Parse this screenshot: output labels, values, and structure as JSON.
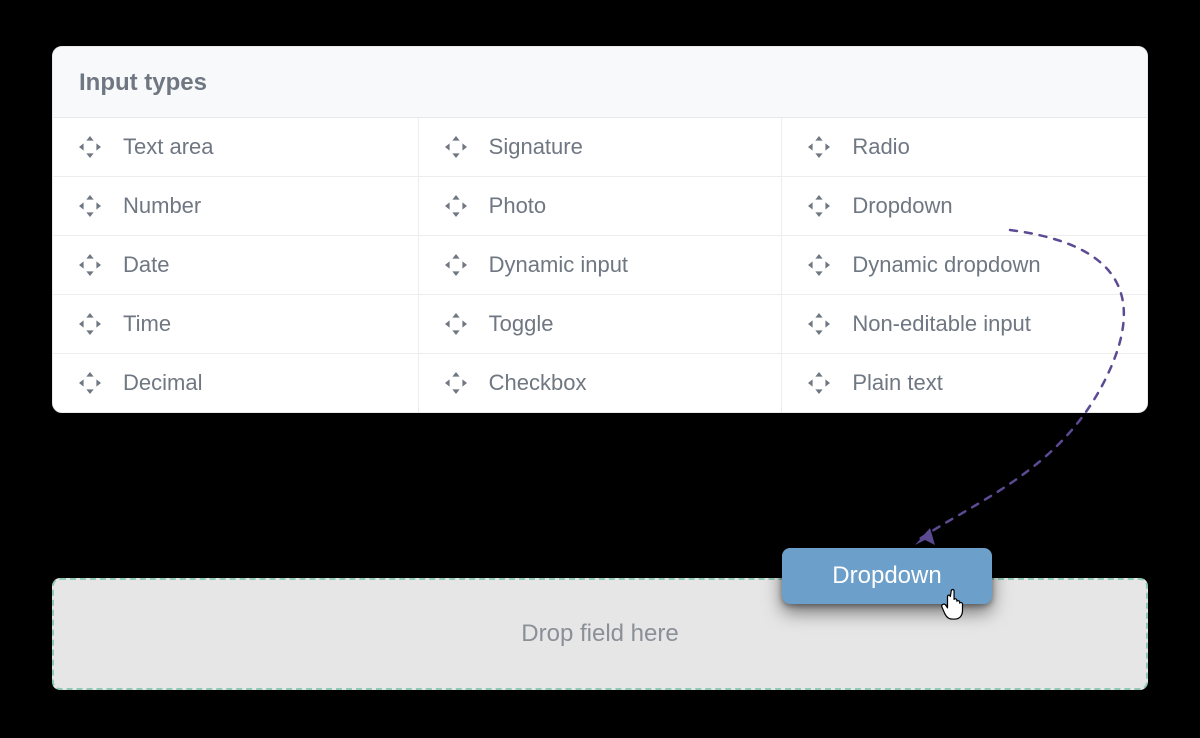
{
  "panel": {
    "title": "Input types",
    "items": [
      {
        "label": "Text area"
      },
      {
        "label": "Signature"
      },
      {
        "label": "Radio"
      },
      {
        "label": "Number"
      },
      {
        "label": "Photo"
      },
      {
        "label": "Dropdown"
      },
      {
        "label": "Date"
      },
      {
        "label": "Dynamic input"
      },
      {
        "label": "Dynamic dropdown"
      },
      {
        "label": "Time"
      },
      {
        "label": "Toggle"
      },
      {
        "label": "Non-editable input"
      },
      {
        "label": "Decimal"
      },
      {
        "label": "Checkbox"
      },
      {
        "label": "Plain text"
      }
    ]
  },
  "dropzone": {
    "placeholder": "Drop field here"
  },
  "dragged": {
    "label": "Dropdown"
  }
}
